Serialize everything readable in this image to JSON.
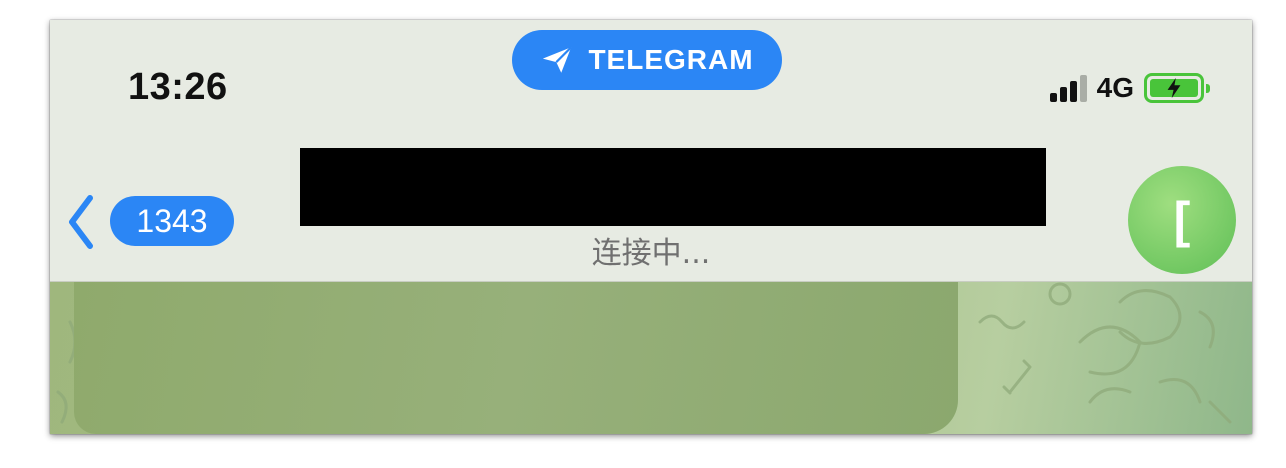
{
  "status_bar": {
    "time": "13:26",
    "network": "4G",
    "signal_bars_active": 3,
    "signal_bars_total": 4,
    "battery_state": "charging",
    "battery_color": "#49c43a"
  },
  "app_pill": {
    "label": "TELEGRAM",
    "icon": "paper-plane-icon",
    "color": "#2b86f5"
  },
  "chat_header": {
    "back_icon": "chevron-left-icon",
    "unread_count": "1343",
    "title_redacted": true,
    "status_text": "连接中...",
    "avatar_initial": "[",
    "avatar_color": "#6cc75f"
  }
}
